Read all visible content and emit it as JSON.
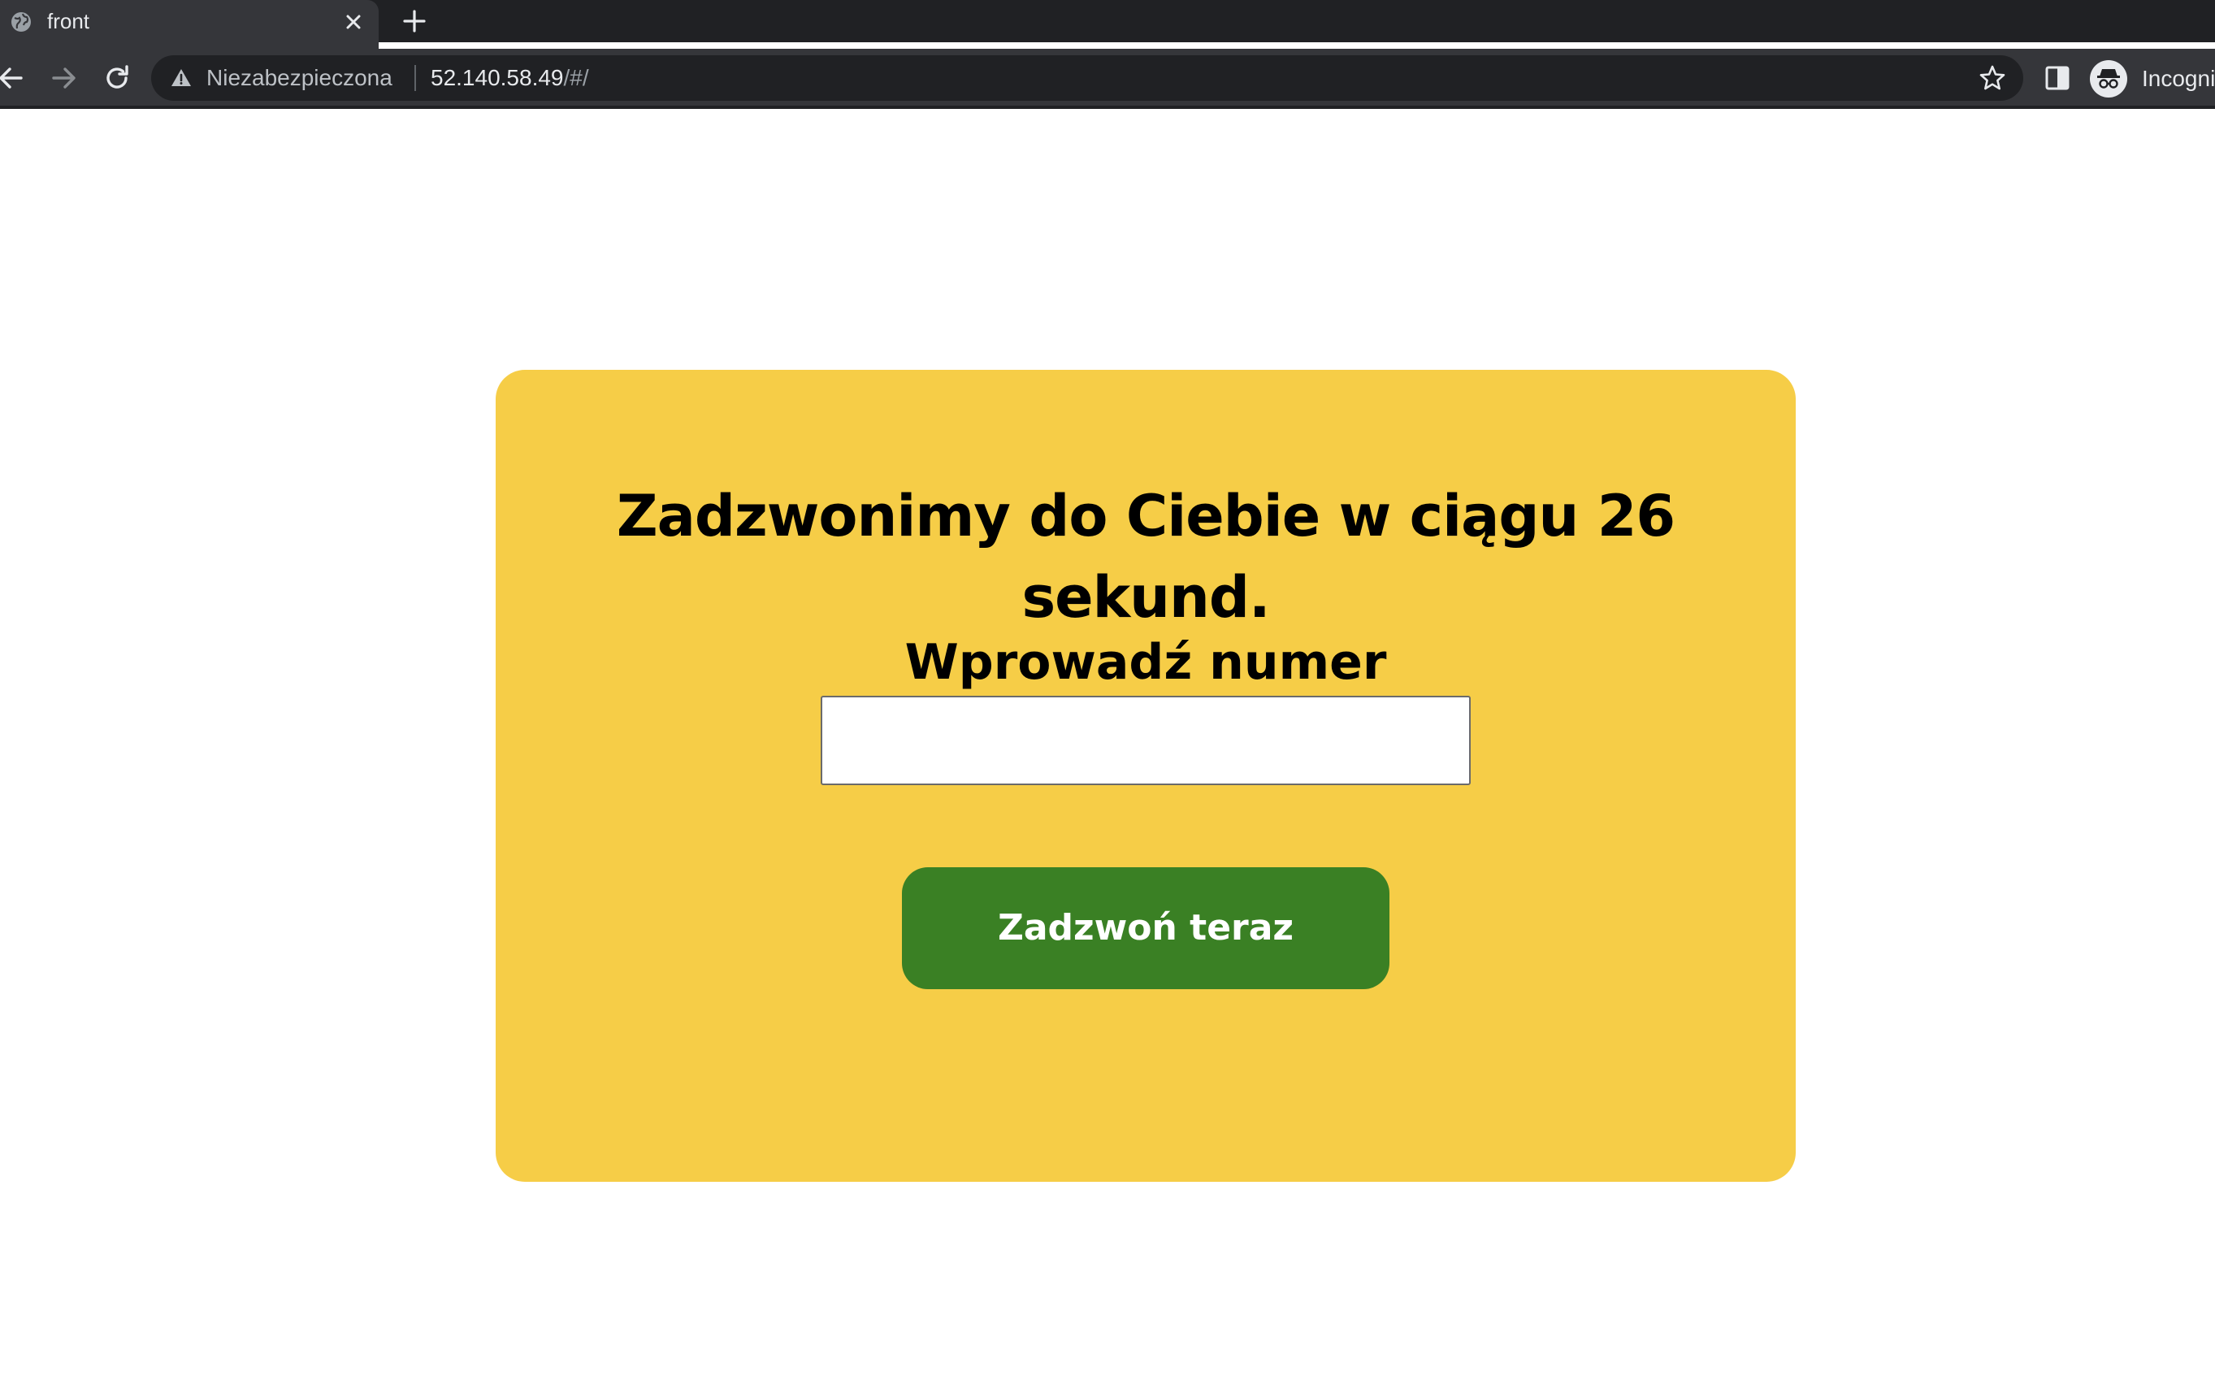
{
  "browser": {
    "tab": {
      "title": "front"
    },
    "omnibox": {
      "security_label": "Niezabezpieczona",
      "url_host": "52.140.58.49",
      "url_path": "/#/"
    },
    "profile": {
      "label": "Incogni"
    },
    "colors": {
      "tabstrip": "#202124",
      "toolbar": "#35363a",
      "omnibox": "#202124"
    }
  },
  "page": {
    "headline": "Zadzwonimy do Ciebie w ciągu 26 sekund.",
    "phone_label": "Wprowadź numer",
    "phone_value": "",
    "call_button_label": "Zadzwoń teraz",
    "colors": {
      "card_background": "#f6cd47",
      "button_background": "#3a8024",
      "button_text": "#ffffff"
    }
  }
}
